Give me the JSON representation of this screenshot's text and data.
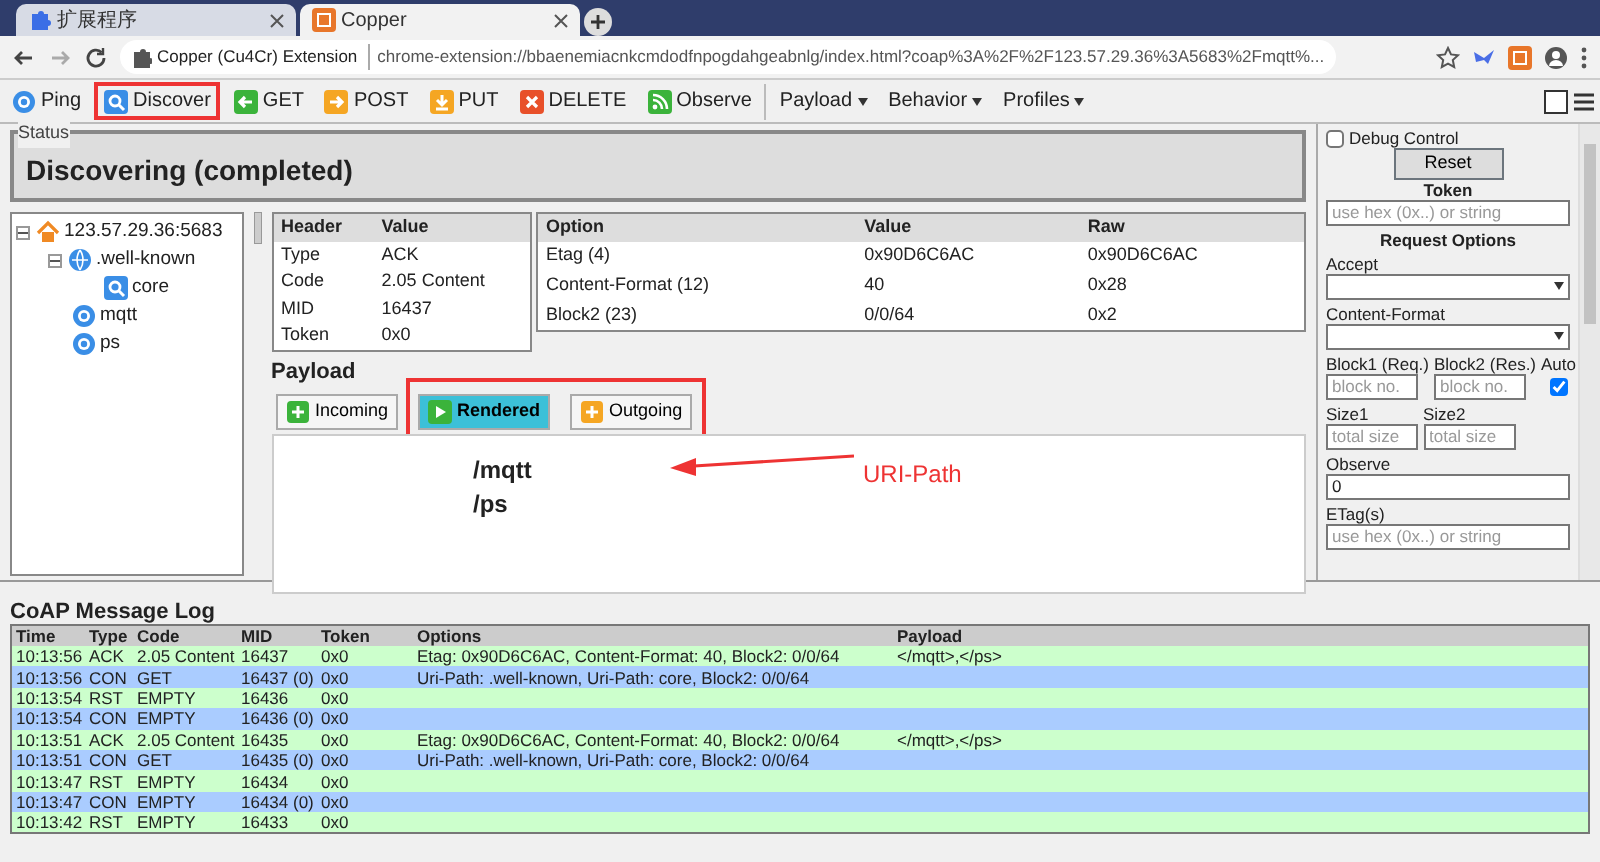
{
  "browser": {
    "tabs": [
      {
        "title": "扩展程序",
        "kind": "puzzle",
        "selected": false
      },
      {
        "title": "Copper",
        "kind": "copper",
        "selected": true
      }
    ],
    "address": {
      "site": "Copper (Cu4Cr) Extension",
      "url": "chrome-extension://bbaenemiacnkcmdodfnpogdahgeabnlg/index.html?coap%3A%2F%2F123.57.29.36%3A5683%2Fmqtt%..."
    }
  },
  "toolbar": {
    "buttons": [
      {
        "label": "Ping",
        "kind": "ping",
        "highlighted": false
      },
      {
        "label": "Discover",
        "kind": "discover",
        "highlighted": true
      },
      {
        "label": "GET",
        "kind": "get",
        "highlighted": false
      },
      {
        "label": "POST",
        "kind": "post",
        "highlighted": false
      },
      {
        "label": "PUT",
        "kind": "put",
        "highlighted": false
      },
      {
        "label": "DELETE",
        "kind": "delete",
        "highlighted": false
      },
      {
        "label": "Observe",
        "kind": "observe",
        "highlighted": false
      }
    ],
    "menus": [
      "Payload",
      "Behavior",
      "Profiles"
    ]
  },
  "status": {
    "legend": "Status",
    "text": "Discovering (completed)"
  },
  "tree": [
    {
      "label": "123.57.29.36:5683",
      "kind": "host",
      "expanded": true,
      "children": [
        {
          "label": ".well-known",
          "kind": "globe",
          "expanded": true,
          "children": [
            {
              "label": "core",
              "kind": "search"
            }
          ]
        },
        {
          "label": "mqtt",
          "kind": "resource"
        },
        {
          "label": "ps",
          "kind": "resource"
        }
      ]
    }
  ],
  "headers": {
    "columns": [
      "Header",
      "Value"
    ],
    "rows": [
      [
        "Type",
        "ACK"
      ],
      [
        "Code",
        "2.05 Content"
      ],
      [
        "MID",
        "16437"
      ],
      [
        "Token",
        "0x0"
      ]
    ]
  },
  "options": {
    "columns": [
      "Option",
      "Value",
      "Raw"
    ],
    "rows": [
      [
        "Etag (4)",
        "0x90D6C6AC",
        "0x90D6C6AC"
      ],
      [
        "Content-Format (12)",
        "40",
        "0x28"
      ],
      [
        "Block2 (23)",
        "0/0/64",
        "0x2"
      ]
    ]
  },
  "payload": {
    "title": "Payload",
    "tabs": [
      {
        "label": "Incoming",
        "kind": "incoming",
        "selected": false
      },
      {
        "label": "Rendered",
        "kind": "rendered",
        "selected": true
      },
      {
        "label": "Outgoing",
        "kind": "outgoing",
        "selected": false
      }
    ],
    "lines": [
      "/mqtt",
      "/ps"
    ],
    "annotation": {
      "label": "URI-Path"
    }
  },
  "side_panel": {
    "debug_control": {
      "label": "Debug Control",
      "checked": false
    },
    "reset": "Reset",
    "token": {
      "label": "Token",
      "placeholder": "use hex (0x..) or string"
    },
    "request_options": "Request Options",
    "fields": [
      {
        "kind": "select",
        "label": "Accept"
      },
      {
        "kind": "select",
        "label": "Content-Format"
      },
      {
        "kind": "pair",
        "items": [
          {
            "label": "Block1 (Req.)",
            "placeholder": "block no."
          },
          {
            "label": "Block2 (Res.)",
            "placeholder": "block no."
          }
        ],
        "check": {
          "label": "Auto",
          "checked": true
        }
      },
      {
        "kind": "pair",
        "items": [
          {
            "label": "Size1",
            "placeholder": "total size"
          },
          {
            "label": "Size2",
            "placeholder": "total size"
          }
        ]
      },
      {
        "kind": "text",
        "label": "Observe",
        "value": "0"
      },
      {
        "kind": "text",
        "label": "ETag(s)",
        "placeholder": "use hex (0x..) or string"
      }
    ]
  },
  "log": {
    "title": "CoAP Message Log",
    "columns": [
      "Time",
      "Type",
      "Code",
      "MID",
      "Token",
      "Options",
      "Payload"
    ],
    "rows": [
      {
        "color": "#ccffcc",
        "cells": [
          "10:13:56",
          "ACK",
          "2.05 Content",
          "16437",
          "0x0",
          "Etag: 0x90D6C6AC, Content-Format: 40, Block2: 0/0/64",
          "</mqtt>,</ps>"
        ]
      },
      {
        "color": "#aaccff",
        "cells": [
          "10:13:56",
          "CON",
          "GET",
          "16437 (0)",
          "0x0",
          "Uri-Path: .well-known, Uri-Path: core, Block2: 0/0/64",
          ""
        ]
      },
      {
        "color": "#ccffcc",
        "cells": [
          "10:13:54",
          "RST",
          "EMPTY",
          "16436",
          "0x0",
          "",
          ""
        ]
      },
      {
        "color": "#aaccff",
        "cells": [
          "10:13:54",
          "CON",
          "EMPTY",
          "16436 (0)",
          "0x0",
          "",
          ""
        ]
      },
      {
        "color": "#ccffcc",
        "cells": [
          "10:13:51",
          "ACK",
          "2.05 Content",
          "16435",
          "0x0",
          "Etag: 0x90D6C6AC, Content-Format: 40, Block2: 0/0/64",
          "</mqtt>,</ps>"
        ]
      },
      {
        "color": "#aaccff",
        "cells": [
          "10:13:51",
          "CON",
          "GET",
          "16435 (0)",
          "0x0",
          "Uri-Path: .well-known, Uri-Path: core, Block2: 0/0/64",
          ""
        ]
      },
      {
        "color": "#ccffcc",
        "cells": [
          "10:13:47",
          "RST",
          "EMPTY",
          "16434",
          "0x0",
          "",
          ""
        ]
      },
      {
        "color": "#aaccff",
        "cells": [
          "10:13:47",
          "CON",
          "EMPTY",
          "16434 (0)",
          "0x0",
          "",
          ""
        ]
      },
      {
        "color": "#ccffcc",
        "cells": [
          "10:13:42",
          "RST",
          "EMPTY",
          "16433",
          "0x0",
          "",
          ""
        ]
      }
    ]
  }
}
